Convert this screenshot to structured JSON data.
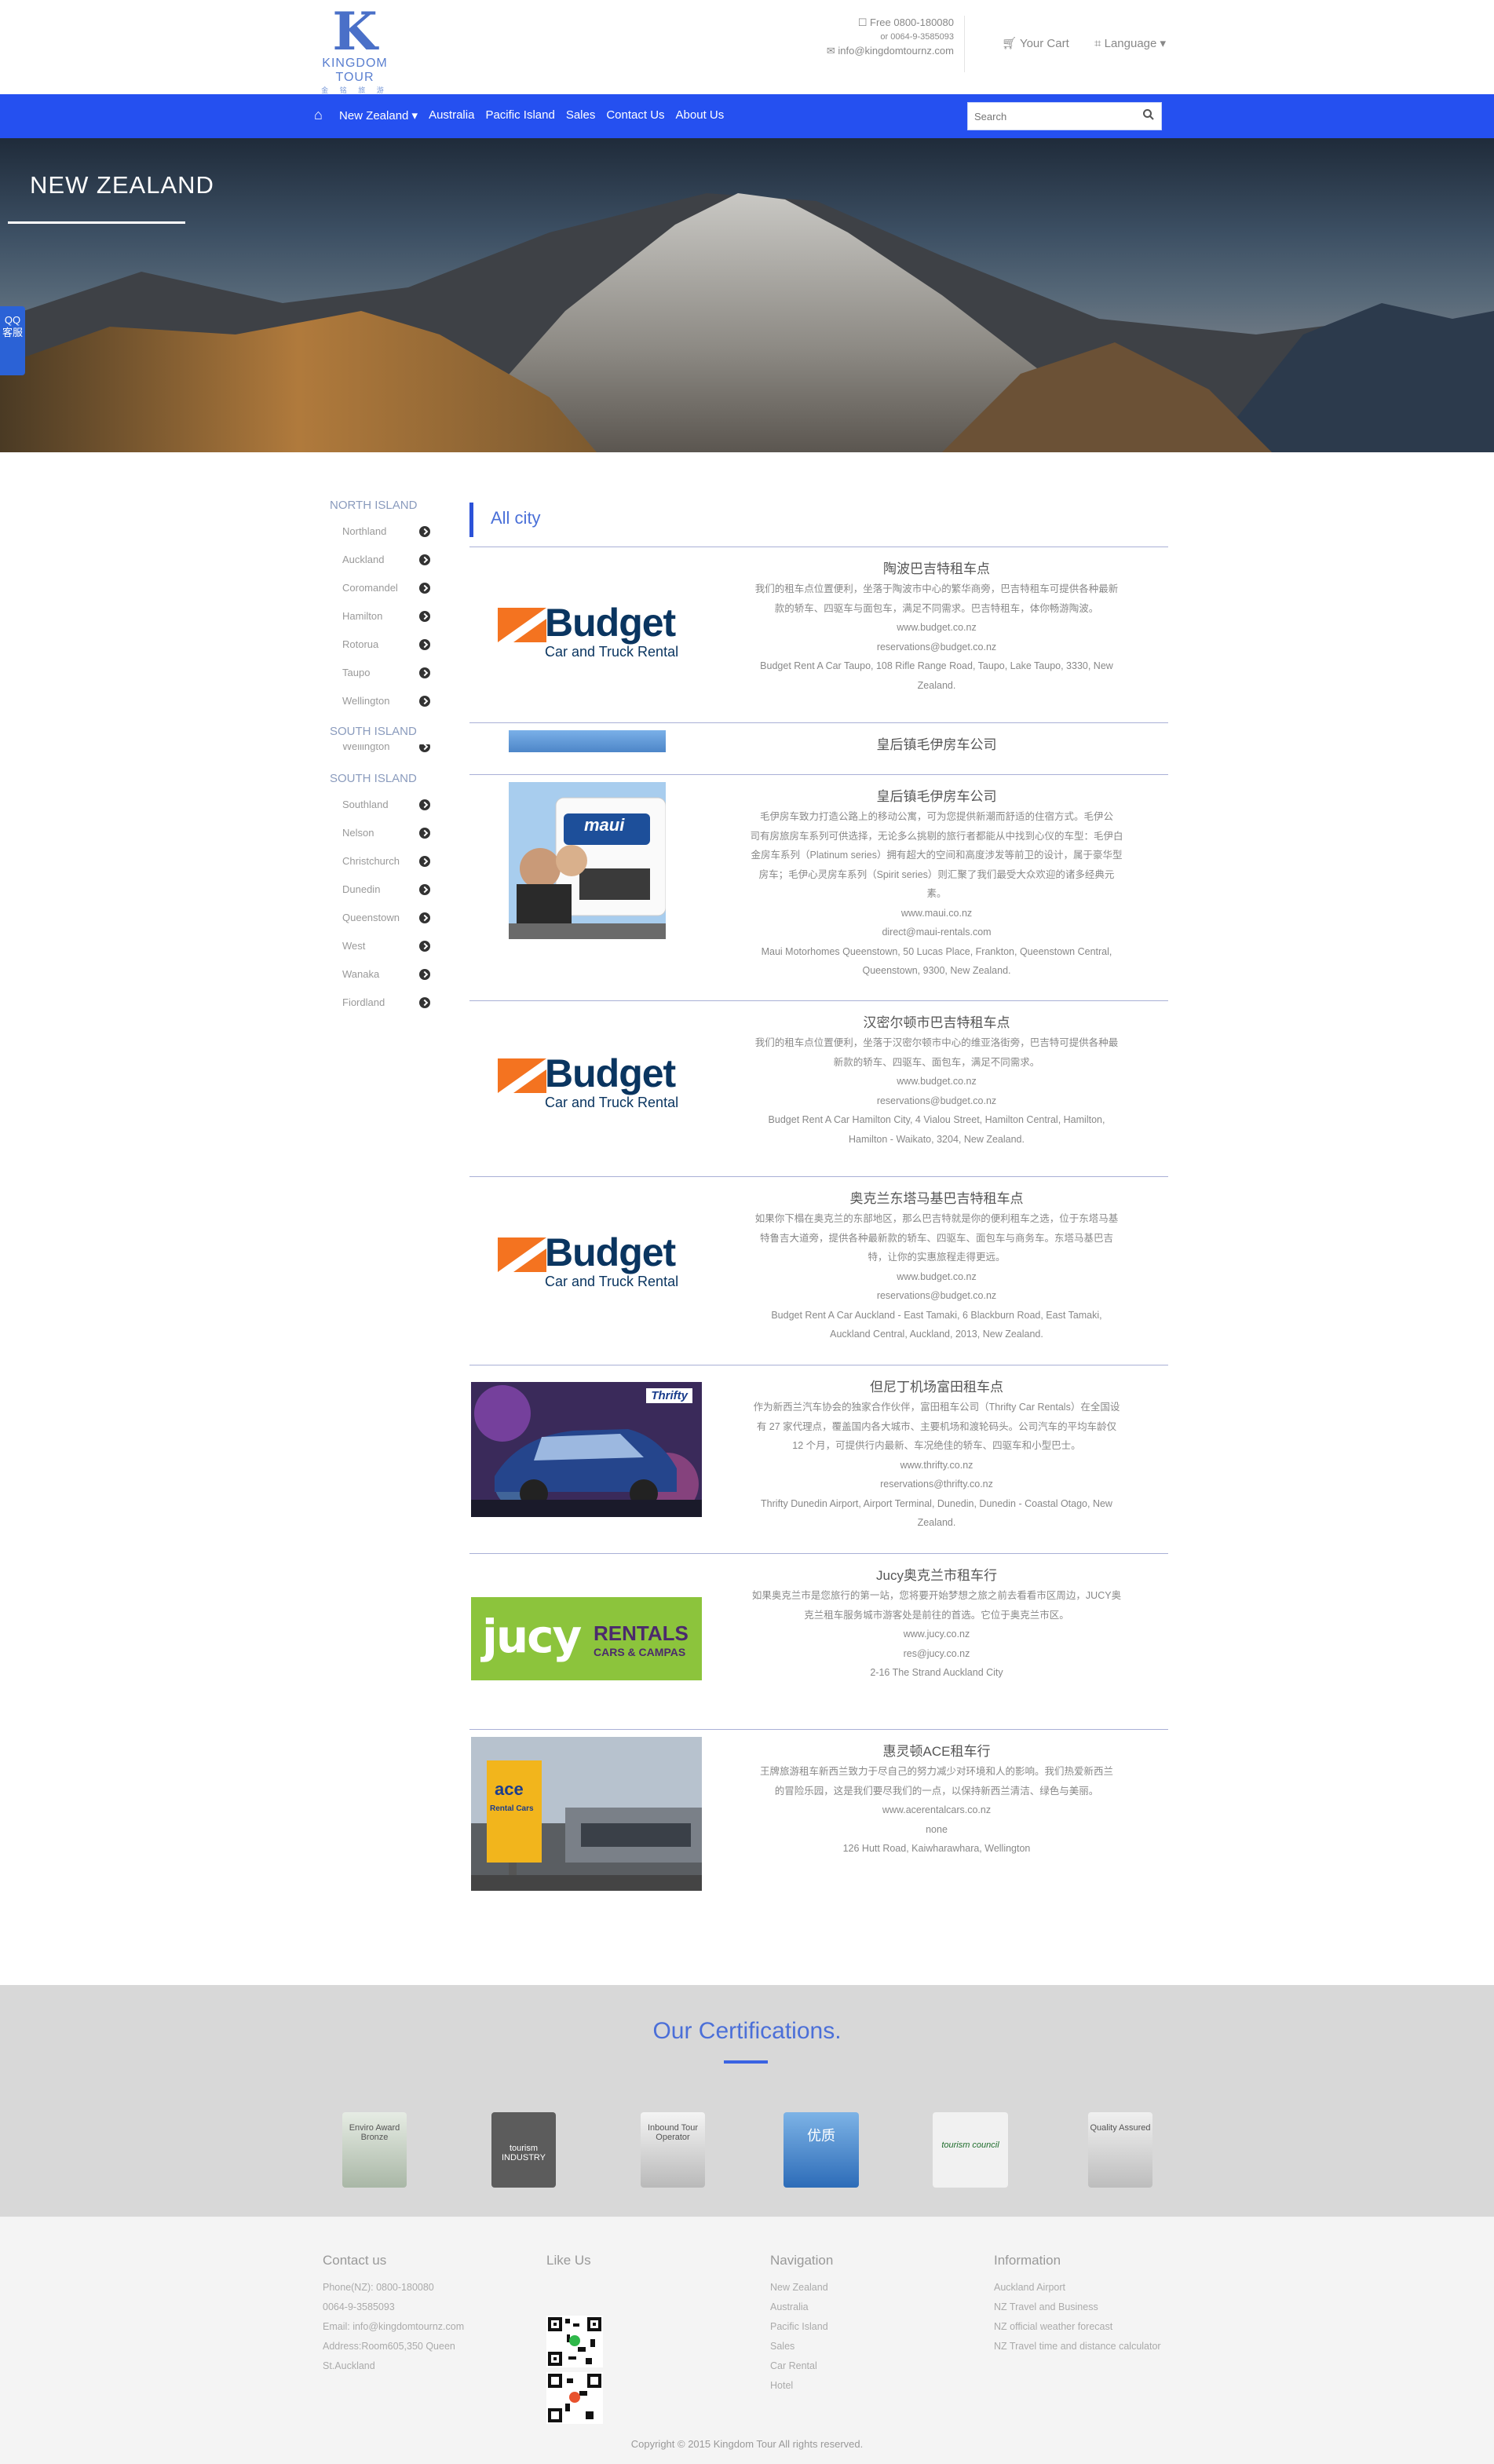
{
  "header": {
    "logo_text": "KINGDOM TOUR",
    "logo_sub": "金 铭 旅 游",
    "phone_free": "Free 0800-180080",
    "phone_alt": "or 0064-9-3585093",
    "email": "info@kingdomtournz.com",
    "cart": "Your Cart",
    "language": "Language"
  },
  "nav": {
    "items": [
      "New Zealand ▾",
      "Australia",
      "Pacific Island",
      "Sales",
      "Contact Us",
      "About Us"
    ],
    "search_placeholder": "Search"
  },
  "hero": {
    "title": "NEW ZEALAND",
    "qq_label": "QQ客服"
  },
  "sidebar": {
    "north_heading": "NORTH ISLAND",
    "north_items": [
      "Northland",
      "Auckland",
      "Coromandel",
      "Hamilton",
      "Rotorua",
      "Taupo",
      "Wellington"
    ],
    "south_heading_1": "SOUTH ISLAND",
    "partial_item": "Wellington",
    "south_heading_2": "SOUTH ISLAND",
    "south_items": [
      "Southland",
      "Nelson",
      "Christchurch",
      "Dunedin",
      "Queenstown",
      "West",
      "Wanaka",
      "Fiordland"
    ]
  },
  "main": {
    "heading": "All city",
    "listings": [
      {
        "title": "陶波巴吉特租车点",
        "lines": [
          "我们的租车点位置便利，坐落于陶波市中心的繁华商旁，巴吉特租车可提供各种最新",
          "款的轿车、四驱车与面包车，满足不同需求。巴吉特租车，体你畅游陶波。",
          "www.budget.co.nz",
          "reservations@budget.co.nz",
          "Budget Rent A Car Taupo, 108 Rifle Range Road, Taupo, Lake Taupo, 3330, New",
          "Zealand."
        ]
      },
      {
        "title": "皇后镇毛伊房车公司",
        "lines": []
      },
      {
        "title": "皇后镇毛伊房车公司",
        "lines": [
          "毛伊房车致力打造公路上的移动公寓，可为您提供新潮而舒适的住宿方式。毛伊公",
          "司有房旅房车系列可供选择，无论多么挑剔的旅行者都能从中找到心仪的车型：毛伊白",
          "金房车系列（Platinum series）拥有超大的空间和高度涉发等前卫的设计，属于豪华型",
          "房车；毛伊心灵房车系列（Spirit series）则汇聚了我们最受大众欢迎的诸多经典元",
          "素。",
          "www.maui.co.nz",
          "direct@maui-rentals.com",
          "Maui Motorhomes Queenstown, 50 Lucas Place, Frankton, Queenstown Central,",
          "Queenstown, 9300, New Zealand."
        ]
      },
      {
        "title": "汉密尔顿市巴吉特租车点",
        "lines": [
          "我们的租车点位置便利，坐落于汉密尔顿市中心的维亚洛街旁，巴吉特可提供各种最",
          "新款的轿车、四驱车、面包车，满足不同需求。",
          "www.budget.co.nz",
          "reservations@budget.co.nz",
          "Budget Rent A Car Hamilton City, 4 Vialou Street, Hamilton Central, Hamilton,",
          "Hamilton - Waikato, 3204, New Zealand."
        ]
      },
      {
        "title": "奥克兰东塔马基巴吉特租车点",
        "lines": [
          "如果你下榻在奥克兰的东部地区，那么巴吉特就是你的便利租车之选，位于东塔马基",
          "特鲁吉大道旁，提供各种最新款的轿车、四驱车、面包车与商务车。东塔马基巴吉",
          "特，让你的实惠旅程走得更远。",
          "www.budget.co.nz",
          "reservations@budget.co.nz",
          "Budget Rent A Car Auckland - East Tamaki, 6 Blackburn Road, East Tamaki,",
          "Auckland Central, Auckland, 2013, New Zealand."
        ]
      },
      {
        "title": "但尼丁机场富田租车点",
        "lines": [
          "作为新西兰汽车协会的独家合作伙伴，富田租车公司（Thrifty Car Rentals）在全国设",
          "有 27 家代理点，覆盖国内各大城市、主要机场和渡轮码头。公司汽车的平均车龄仅",
          "12 个月，可提供行内最新、车况绝佳的轿车、四驱车和小型巴士。",
          "www.thrifty.co.nz",
          "reservations@thrifty.co.nz",
          "Thrifty Dunedin Airport, Airport Terminal, Dunedin, Dunedin - Coastal Otago, New",
          "Zealand."
        ]
      },
      {
        "title": "Jucy奥克兰市租车行",
        "lines": [
          "如果奥克兰市是您旅行的第一站，您将要开始梦想之旅之前去看看市区周边，JUCY奥",
          "克兰租车服务城市游客处是前往的首选。它位于奥克兰市区。",
          "www.jucy.co.nz",
          "res@jucy.co.nz",
          "2-16 The Strand Auckland City"
        ]
      },
      {
        "title": "惠灵顿ACE租车行",
        "lines": [
          "王牌旅游租车新西兰致力于尽自己的努力减少对环境和人的影响。我们热爱新西兰",
          "的冒险乐园，这是我们要尽我们的一点，以保持新西兰清洁、绿色与美丽。",
          "www.acerentalcars.co.nz",
          "none",
          "126 Hutt Road, Kaiwharawhara, Wellington"
        ]
      }
    ],
    "budget_word": "Budget",
    "budget_sub": "Car and Truck Rental",
    "maui_word": "maui",
    "thrifty_word": "Thrifty",
    "jucy_word": "jucy",
    "jucy_rentals": "RENTALS",
    "jucy_sub": "CARS & CAMPAS",
    "ace_word": "ace",
    "ace_sub": "Rental Cars"
  },
  "certifications": {
    "title": "Our Certifications.",
    "badges": [
      "Enviro Award Bronze",
      "tourism INDUSTRY",
      "Inbound Tour Operator",
      "优质",
      "tourism council",
      "Quality Assured"
    ]
  },
  "footer": {
    "contact_heading": "Contact us",
    "contact_lines": [
      "Phone(NZ): 0800-180080",
      "0064-9-3585093",
      "Email: info@kingdomtournz.com",
      "Address:Room605,350 Queen",
      "St.Auckland"
    ],
    "like_heading": "Like Us",
    "nav_heading": "Navigation",
    "nav_links": [
      "New Zealand",
      "Australia",
      "Pacific Island",
      "Sales",
      "Car Rental",
      "Hotel"
    ],
    "info_heading": "Information",
    "info_links": [
      "Auckland Airport",
      "NZ Travel and Business",
      "NZ official weather forecast",
      "NZ Travel time and distance calculator"
    ],
    "copyright": "Copyright © 2015 Kingdom Tour All rights reserved."
  },
  "colors": {
    "nav_blue": "#2550f0",
    "accent_blue": "#4a70d8",
    "budget_orange": "#f47320",
    "budget_navy": "#0a3560",
    "jucy_green": "#8cc43c"
  }
}
